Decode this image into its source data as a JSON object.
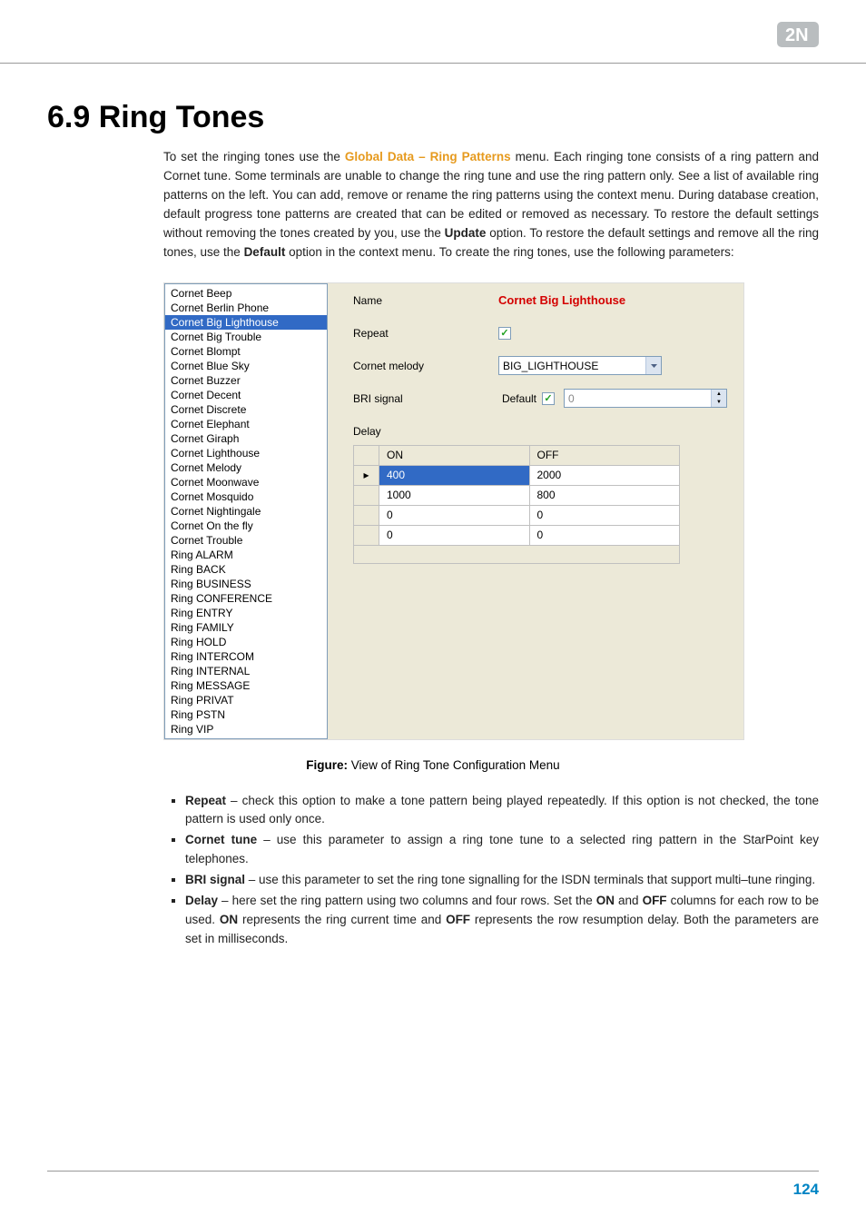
{
  "header": {
    "logo_alt": "2N"
  },
  "title": "6.9 Ring Tones",
  "intro": {
    "part1": "To set the ringing tones use the ",
    "highlight": "Global Data – Ring Patterns",
    "part2": " menu. Each ringing tone consists of a ring pattern and Cornet tune. Some terminals are unable to change the ring tune and use the ring pattern only. See a list of available ring patterns on the left. You can add, remove or rename the ring patterns using the context menu. During database creation, default progress tone patterns are created that can be edited or removed as necessary. To restore the default settings without removing the tones created by you, use the ",
    "bold1": "Update",
    "part3": " option. To restore the default settings and remove all the ring tones, use the ",
    "bold2": "Default",
    "part4": " option in the context menu. To create the ring tones, use the following parameters:"
  },
  "figure": {
    "list": [
      "Cornet Beep",
      "Cornet Berlin Phone",
      "Cornet Big Lighthouse",
      "Cornet Big Trouble",
      "Cornet Blompt",
      "Cornet Blue Sky",
      "Cornet Buzzer",
      "Cornet Decent",
      "Cornet Discrete",
      "Cornet Elephant",
      "Cornet Giraph",
      "Cornet Lighthouse",
      "Cornet Melody",
      "Cornet Moonwave",
      "Cornet Mosquido",
      "Cornet Nightingale",
      "Cornet On the fly",
      "Cornet Trouble",
      "Ring ALARM",
      "Ring BACK",
      "Ring BUSINESS",
      "Ring CONFERENCE",
      "Ring ENTRY",
      "Ring FAMILY",
      "Ring HOLD",
      "Ring INTERCOM",
      "Ring INTERNAL",
      "Ring MESSAGE",
      "Ring PRIVAT",
      "Ring PSTN",
      "Ring VIP"
    ],
    "selected_index": 2,
    "labels": {
      "name": "Name",
      "repeat": "Repeat",
      "cornet_melody": "Cornet melody",
      "bri_signal": "BRI signal",
      "default": "Default",
      "delay": "Delay",
      "on": "ON",
      "off": "OFF"
    },
    "values": {
      "name": "Cornet Big Lighthouse",
      "repeat_checked": true,
      "cornet_melody": "BIG_LIGHTHOUSE",
      "bri_default_checked": true,
      "bri_value": "0"
    },
    "delay_rows": [
      {
        "on": "400",
        "off": "2000",
        "selected": true
      },
      {
        "on": "1000",
        "off": "800",
        "selected": false
      },
      {
        "on": "0",
        "off": "0",
        "selected": false
      },
      {
        "on": "0",
        "off": "0",
        "selected": false
      }
    ]
  },
  "caption": {
    "bold": "Figure:",
    "text": " View of Ring Tone Configuration Menu"
  },
  "bullets": [
    {
      "bold": "Repeat",
      "dash": " – ",
      "text": "check this option to make a tone pattern being played repeatedly. If this option is not checked, the tone pattern is used only once."
    },
    {
      "bold": "Cornet tune",
      "dash": " – ",
      "text": "use this parameter to assign a ring tone tune to a selected ring pattern in the StarPoint key telephones."
    },
    {
      "bold": "BRI signal",
      "dash": " – ",
      "text": "use this parameter to set the ring tone signalling for the ISDN terminals that support multi–tune ringing."
    },
    {
      "bold": "Delay",
      "dash": " – ",
      "text_before_on": "here set the ring pattern using two columns and four rows. Set the ",
      "on": "ON",
      "text_mid1": " and ",
      "off": "OFF",
      "text_mid2": " columns for each row to be used. ",
      "on2": "ON",
      "text_mid3": " represents the ring current time and ",
      "off2": "OFF",
      "text_end": " represents the row resumption delay. Both the parameters are set in milliseconds."
    }
  ],
  "page_number": "124"
}
